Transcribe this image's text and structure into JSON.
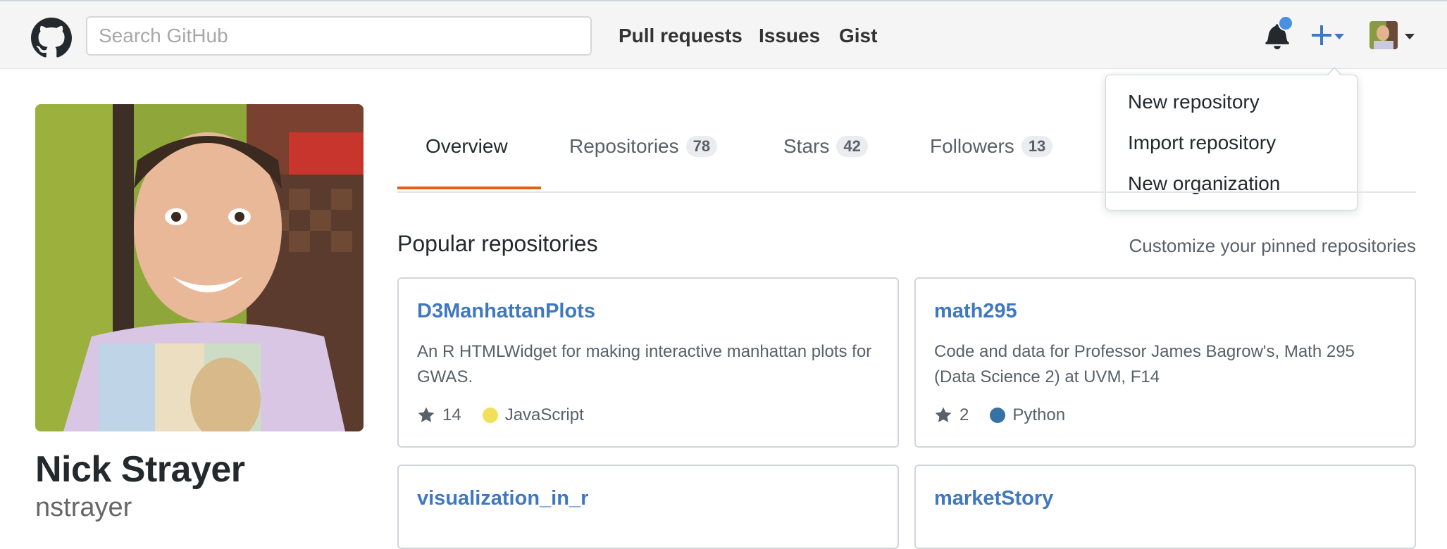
{
  "header": {
    "search_placeholder": "Search GitHub",
    "nav": [
      "Pull requests",
      "Issues",
      "Gist"
    ]
  },
  "dropdown": {
    "items": [
      "New repository",
      "Import repository",
      "New organization"
    ]
  },
  "profile": {
    "name": "Nick Strayer",
    "username": "nstrayer"
  },
  "tabs": [
    {
      "label": "Overview"
    },
    {
      "label": "Repositories",
      "count": "78"
    },
    {
      "label": "Stars",
      "count": "42"
    },
    {
      "label": "Followers",
      "count": "13"
    }
  ],
  "popular": {
    "title": "Popular repositories",
    "customize": "Customize your pinned repositories"
  },
  "repos": [
    {
      "name": "D3ManhattanPlots",
      "description": "An R HTMLWidget for making interactive manhattan plots for GWAS.",
      "stars": "14",
      "language": "JavaScript",
      "lang_color": "#f1e05a"
    },
    {
      "name": "math295",
      "description": "Code and data for Professor James Bagrow's, Math 295 (Data Science 2) at UVM, F14",
      "stars": "2",
      "language": "Python",
      "lang_color": "#3572A5"
    },
    {
      "name": "visualization_in_r"
    },
    {
      "name": "marketStory"
    }
  ],
  "colors": {
    "accent_link": "#4078c0",
    "tab_underline": "#e36209",
    "notification": "#4a90e2"
  }
}
